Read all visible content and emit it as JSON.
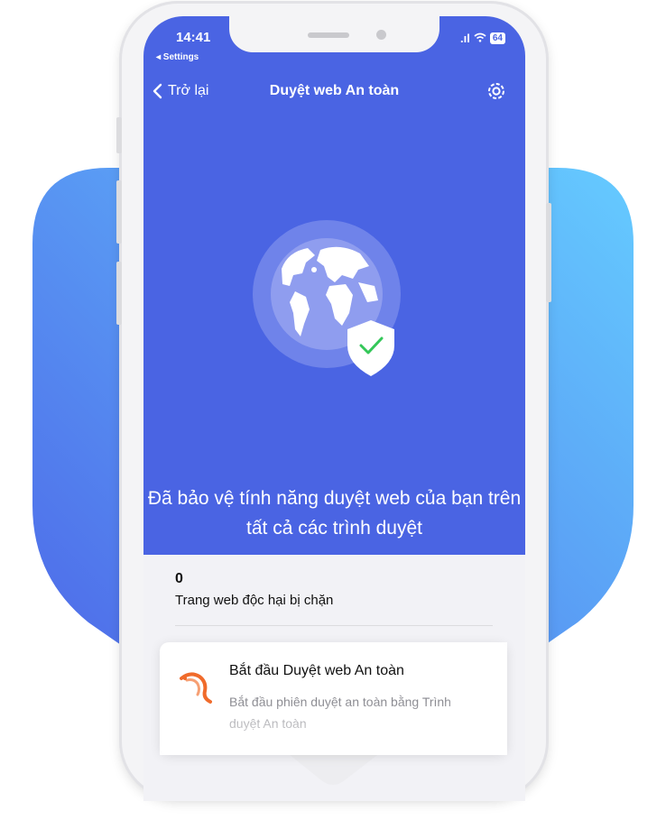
{
  "status_bar": {
    "time": "14:41",
    "back_app": "◂ Settings",
    "battery": "64"
  },
  "nav": {
    "back_label": "Trở lại",
    "title": "Duyệt web An toàn"
  },
  "hero": {
    "message": "Đã bảo vệ tính năng duyệt web của bạn trên tất cả các trình duyệt"
  },
  "stats": {
    "blocked_count": "0",
    "blocked_label": "Trang web độc hại bị chặn"
  },
  "card": {
    "title": "Bắt đầu Duyệt web An toàn",
    "description": "Bắt đầu phiên duyệt an toàn bằng Trình duyệt An toàn"
  },
  "colors": {
    "hero_blue": "#4a64e3",
    "accent_orange": "#f06b2b",
    "check_green": "#34c759"
  },
  "icons": [
    "chevron-left-icon",
    "gear-icon",
    "globe-icon",
    "shield-check-icon",
    "shrimp-icon"
  ]
}
